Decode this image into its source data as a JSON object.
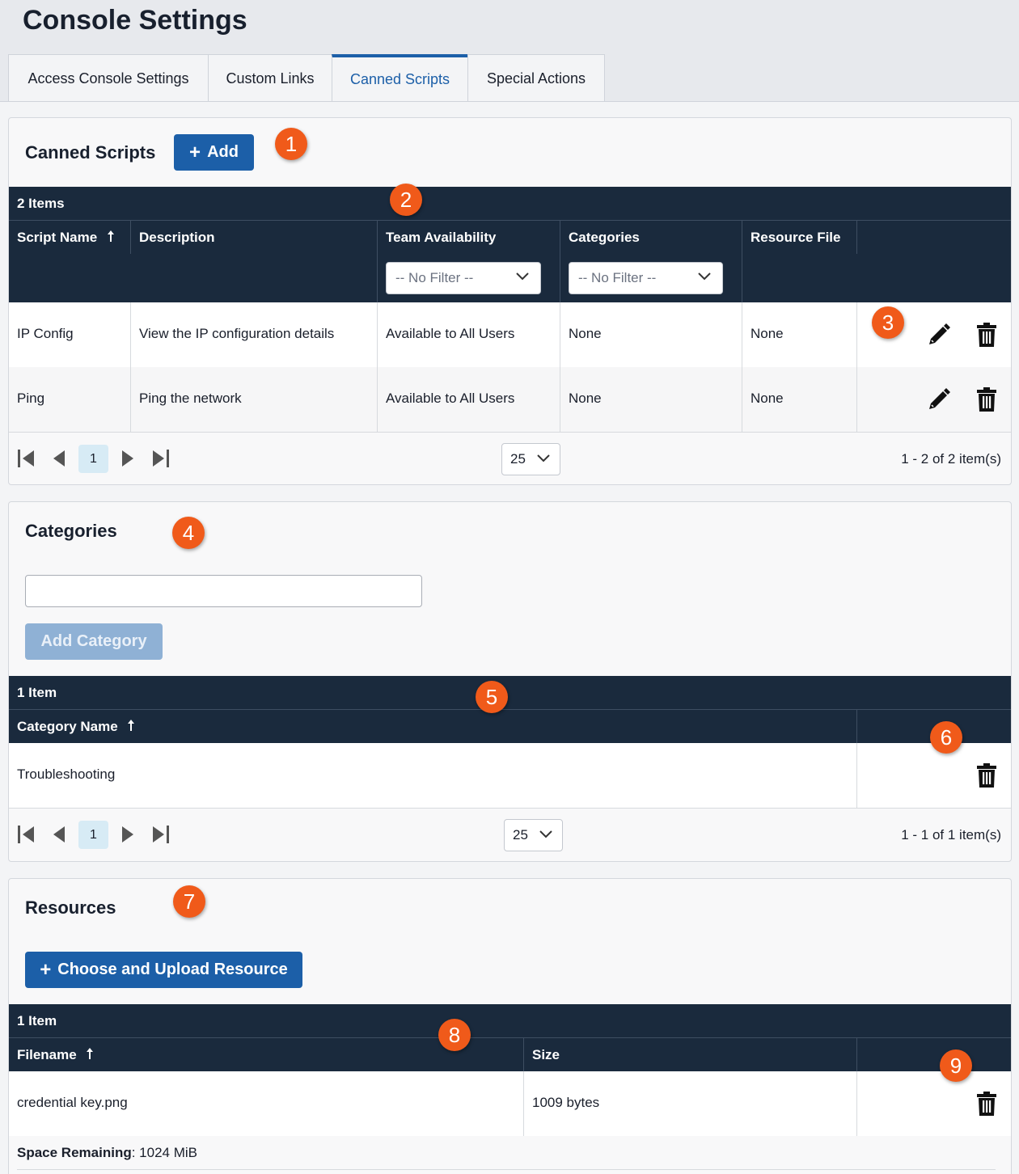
{
  "page": {
    "title": "Console Settings"
  },
  "tabs": [
    {
      "label": "Access Console Settings"
    },
    {
      "label": "Custom Links"
    },
    {
      "label": "Canned Scripts"
    },
    {
      "label": "Special Actions"
    }
  ],
  "active_tab": "Canned Scripts",
  "colors": {
    "accent": "#1c5fa8",
    "header": "#1a2a3d",
    "marker": "#f05a1a"
  },
  "markers": [
    "1",
    "2",
    "3",
    "4",
    "5",
    "6",
    "7",
    "8",
    "9"
  ],
  "canned_scripts": {
    "title": "Canned Scripts",
    "add_label": "Add",
    "count": "2 Items",
    "columns": {
      "script_name": "Script Name",
      "description": "Description",
      "team_availability": "Team Availability",
      "categories": "Categories",
      "resource_file": "Resource File"
    },
    "filters": {
      "team_availability": "-- No Filter --",
      "categories": "-- No Filter --"
    },
    "rows": [
      {
        "name": "IP Config",
        "description": "View the IP configuration details",
        "team": "Available to All Users",
        "categories": "None",
        "resource": "None"
      },
      {
        "name": "Ping",
        "description": "Ping the network",
        "team": "Available to All Users",
        "categories": "None",
        "resource": "None"
      }
    ],
    "pager": {
      "page": "1",
      "page_size": "25",
      "info": "1 - 2 of 2 item(s)"
    }
  },
  "categories": {
    "title": "Categories",
    "input_value": "",
    "add_label": "Add Category",
    "count": "1 Item",
    "columns": {
      "name": "Category Name"
    },
    "rows": [
      {
        "name": "Troubleshooting"
      }
    ],
    "pager": {
      "page": "1",
      "page_size": "25",
      "info": "1 - 1 of 1 item(s)"
    }
  },
  "resources": {
    "title": "Resources",
    "upload_label": "Choose and Upload Resource",
    "count": "1 Item",
    "columns": {
      "filename": "Filename",
      "size": "Size"
    },
    "rows": [
      {
        "filename": "credential key.png",
        "size": "1009 bytes"
      }
    ],
    "space_label": "Space Remaining",
    "space_value": ": 1024 MiB"
  }
}
